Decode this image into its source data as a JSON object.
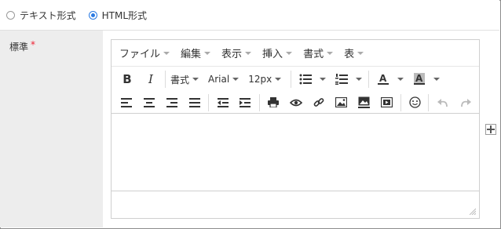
{
  "format_options": {
    "text": "テキスト形式",
    "html": "HTML形式",
    "selected": "html"
  },
  "field": {
    "label": "標準",
    "required_mark": "*"
  },
  "menubar": {
    "items": [
      "ファイル",
      "編集",
      "表示",
      "挿入",
      "書式",
      "表"
    ]
  },
  "toolbar": {
    "bold": "B",
    "italic": "I",
    "format": "書式",
    "font": "Arial",
    "size": "12px",
    "font_color_letter": "A",
    "bg_color_letter": "A"
  },
  "colors": {
    "accent": "#2a7ae2",
    "required": "#e22233",
    "label_bg": "#ededed"
  }
}
